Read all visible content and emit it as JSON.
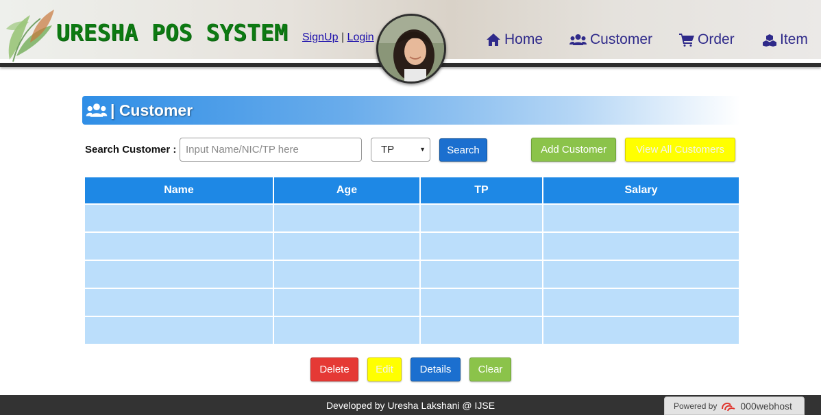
{
  "header": {
    "brand": "URESHA POS SYSTEM",
    "signup": "SignUp",
    "separator": "|",
    "login": "Login",
    "nav": {
      "home": "Home",
      "customer": "Customer",
      "order": "Order",
      "item": "Item"
    },
    "nav_color": "#2f2a8a",
    "brand_color": "#0d7a12"
  },
  "section": {
    "title": "| Customer",
    "icon": "users-icon"
  },
  "search": {
    "label": "Search Customer :",
    "placeholder": "Input Name/NIC/TP here",
    "value": "",
    "select_value": "TP",
    "search_button": "Search",
    "add_button": "Add Customer",
    "view_all_button": "View All Customers"
  },
  "table": {
    "columns": [
      "Name",
      "Age",
      "TP",
      "Salary"
    ],
    "rows": [
      [
        "",
        "",
        "",
        ""
      ],
      [
        "",
        "",
        "",
        ""
      ],
      [
        "",
        "",
        "",
        ""
      ],
      [
        "",
        "",
        "",
        ""
      ],
      [
        "",
        "",
        "",
        ""
      ]
    ],
    "header_color": "#1e88e5",
    "row_color": "#bbdefb"
  },
  "actions": {
    "delete": "Delete",
    "edit": "Edit",
    "details": "Details",
    "clear": "Clear"
  },
  "footer": {
    "text": "Developed by Uresha Lakshani @ IJSE",
    "powered_by": "Powered by",
    "host": "000webhost"
  }
}
